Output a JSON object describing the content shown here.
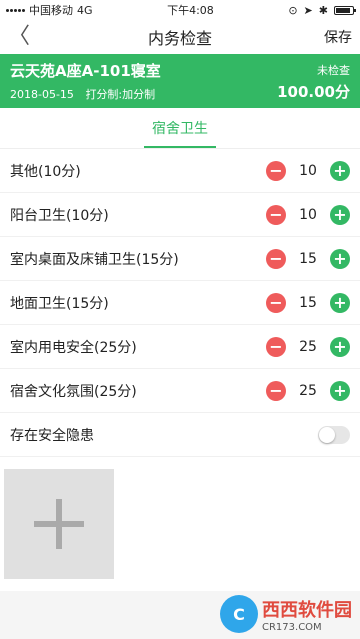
{
  "statusbar": {
    "carrier": "中国移动",
    "network": "4G",
    "time": "下午4:08",
    "battery_level": 0.8
  },
  "nav": {
    "back": "〈",
    "title": "内务检查",
    "save": "保存"
  },
  "banner": {
    "title": "云天苑A座A-101寝室",
    "date": "2018-05-15",
    "mode": "打分制:加分制",
    "status": "未检查",
    "score": "100.00分"
  },
  "tabs": [
    {
      "label": "宿舍卫生",
      "active": true
    }
  ],
  "items": [
    {
      "label": "其他(10分)",
      "value": "10"
    },
    {
      "label": "阳台卫生(10分)",
      "value": "10"
    },
    {
      "label": "室内桌面及床铺卫生(15分)",
      "value": "15"
    },
    {
      "label": "地面卫生(15分)",
      "value": "15"
    },
    {
      "label": "室内用电安全(25分)",
      "value": "25"
    },
    {
      "label": "宿舍文化氛围(25分)",
      "value": "25"
    }
  ],
  "hazard": {
    "label": "存在安全隐患",
    "enabled": false
  },
  "watermark": {
    "logo": "C",
    "main": "西西软件园",
    "sub": "CR173.COM"
  },
  "colors": {
    "accent": "#33b864",
    "minus": "#ef5b5b"
  },
  "icons": [
    "back-arrow-icon",
    "minus-icon",
    "plus-icon",
    "add-photo-icon",
    "toggle-icon"
  ]
}
